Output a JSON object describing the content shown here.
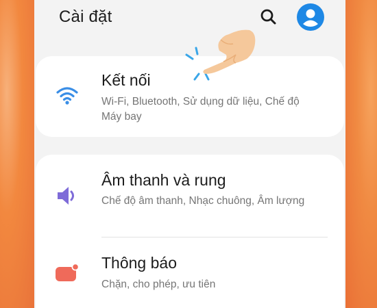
{
  "header": {
    "title": "Cài đặt",
    "search_icon": "search-icon",
    "profile_icon": "account-circle-icon"
  },
  "settings": [
    {
      "id": "connections",
      "icon": "wifi-icon",
      "icon_color": "#3a8ee6",
      "title": "Kết nối",
      "description": "Wi-Fi, Bluetooth, Sử dụng dữ liệu, Chế độ Máy bay"
    },
    {
      "id": "sounds",
      "icon": "speaker-icon",
      "icon_color": "#7e6bd8",
      "title": "Âm thanh và rung",
      "description": "Chế độ âm thanh, Nhạc chuông, Âm lượng"
    },
    {
      "id": "notifications",
      "icon": "notification-icon",
      "icon_color": "#ef6a5a",
      "title": "Thông báo",
      "description": "Chặn, cho phép, ưu tiên"
    }
  ],
  "colors": {
    "background": "#f3f3f3",
    "card": "#ffffff",
    "accent": "#1e88e5"
  }
}
